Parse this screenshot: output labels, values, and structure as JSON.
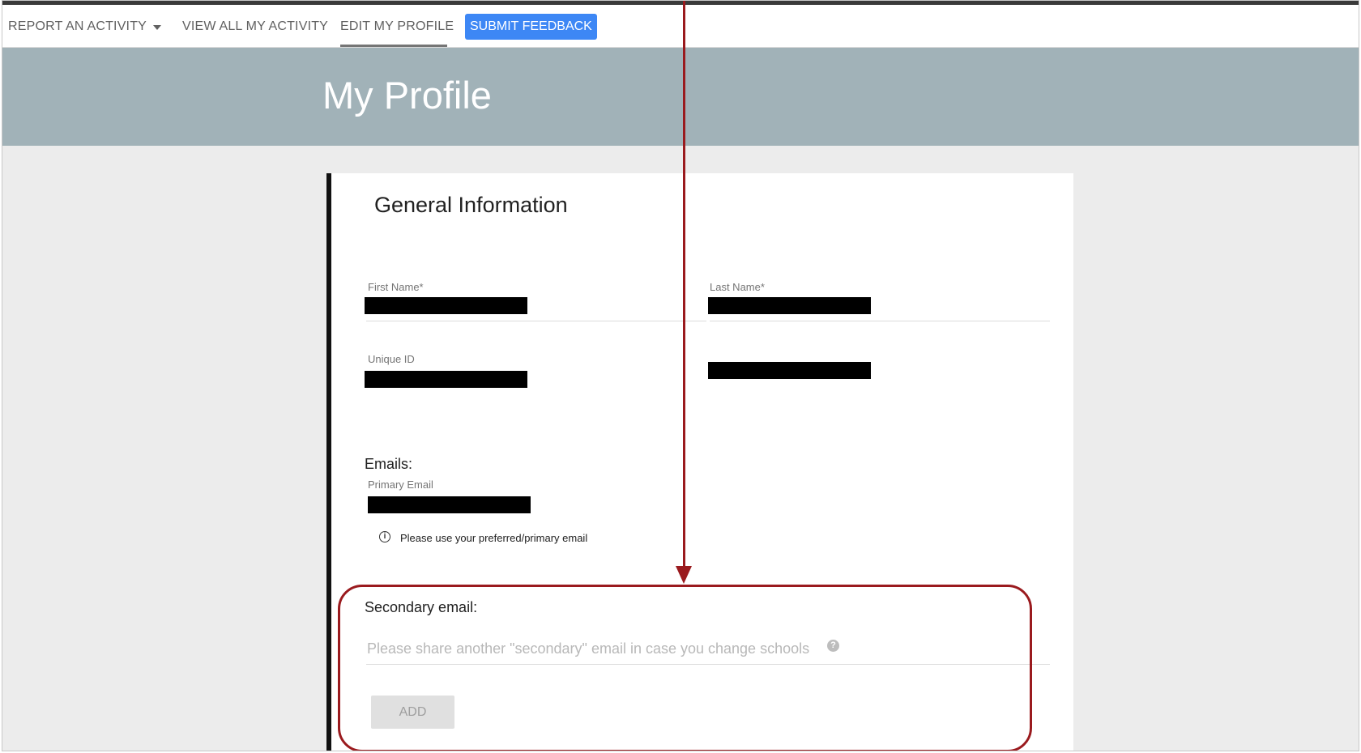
{
  "nav": {
    "items": [
      {
        "label": "REPORT AN ACTIVITY"
      },
      {
        "label": "VIEW ALL MY ACTIVITY"
      },
      {
        "label": "EDIT MY PROFILE"
      }
    ],
    "feedback_label": "SUBMIT FEEDBACK",
    "active_item": "EDIT MY PROFILE"
  },
  "banner": {
    "title": "My Profile"
  },
  "general": {
    "title": "General Information",
    "first_name_label": "First Name*",
    "last_name_label": "Last Name*",
    "unique_id_label": "Unique ID",
    "emails_heading": "Emails:",
    "primary_email_label": "Primary Email",
    "primary_email_hint": "Please use your preferred/primary email"
  },
  "secondary": {
    "label": "Secondary email:",
    "placeholder": "Please share another \"secondary\" email in case you change schools",
    "add_label": "ADD"
  },
  "colors": {
    "accent_blue": "#3d87f5",
    "banner": "#a1b2b8",
    "annotation_red": "#9a1a1e"
  },
  "icons": {
    "info": "info-circle-icon",
    "help": "question-circle-icon",
    "caret": "chevron-down-icon"
  }
}
